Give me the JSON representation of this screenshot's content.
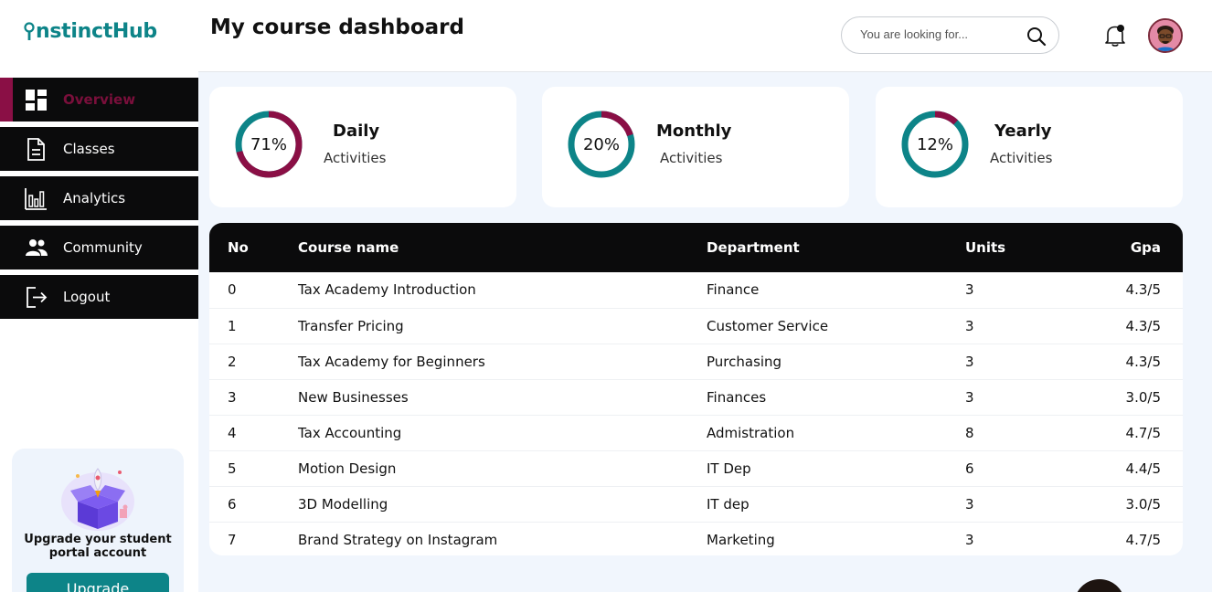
{
  "brand": {
    "name_rest": "nstinctHub",
    "color": "#0d8488"
  },
  "sidebar": {
    "items": [
      {
        "label": "Overview",
        "icon": "dashboard-icon",
        "active": true
      },
      {
        "label": "Classes",
        "icon": "document-icon"
      },
      {
        "label": "Analytics",
        "icon": "bar-chart-icon"
      },
      {
        "label": "Community",
        "icon": "people-icon"
      },
      {
        "label": "Logout",
        "icon": "logout-icon"
      }
    ],
    "upgrade": {
      "title": "Upgrade your student portal account",
      "button": "Upgrade"
    }
  },
  "header": {
    "title": "My course dashboard",
    "search_placeholder": "You are looking for..."
  },
  "stats": [
    {
      "value": "71%",
      "percent": 71,
      "title": "Daily",
      "sub": "Activities"
    },
    {
      "value": "20%",
      "percent": 20,
      "title": "Monthly",
      "sub": "Activities"
    },
    {
      "value": "12%",
      "percent": 12,
      "title": "Yearly",
      "sub": "Activities"
    }
  ],
  "colors": {
    "accent": "#8a0f45",
    "teal": "#0d8488",
    "dark": "#0b0b0c"
  },
  "table": {
    "headers": [
      "No",
      "Course name",
      "Department",
      "Units",
      "Gpa"
    ],
    "rows": [
      [
        "0",
        "Tax Academy Introduction",
        "Finance",
        "3",
        "4.3/5"
      ],
      [
        "1",
        "Transfer Pricing",
        "Customer Service",
        "3",
        "4.3/5"
      ],
      [
        "2",
        "Tax Academy for Beginners",
        "Purchasing",
        "3",
        "4.3/5"
      ],
      [
        "3",
        "New Businesses",
        "Finances",
        "3",
        "3.0/5"
      ],
      [
        "4",
        "Tax Accounting",
        "Admistration",
        "8",
        "4.7/5"
      ],
      [
        "5",
        "Motion Design",
        "IT Dep",
        "6",
        "4.4/5"
      ],
      [
        "6",
        "3D Modelling",
        "IT dep",
        "3",
        "3.0/5"
      ],
      [
        "7",
        "Brand Strategy on Instagram",
        "Marketing",
        "3",
        "4.7/5"
      ]
    ]
  }
}
